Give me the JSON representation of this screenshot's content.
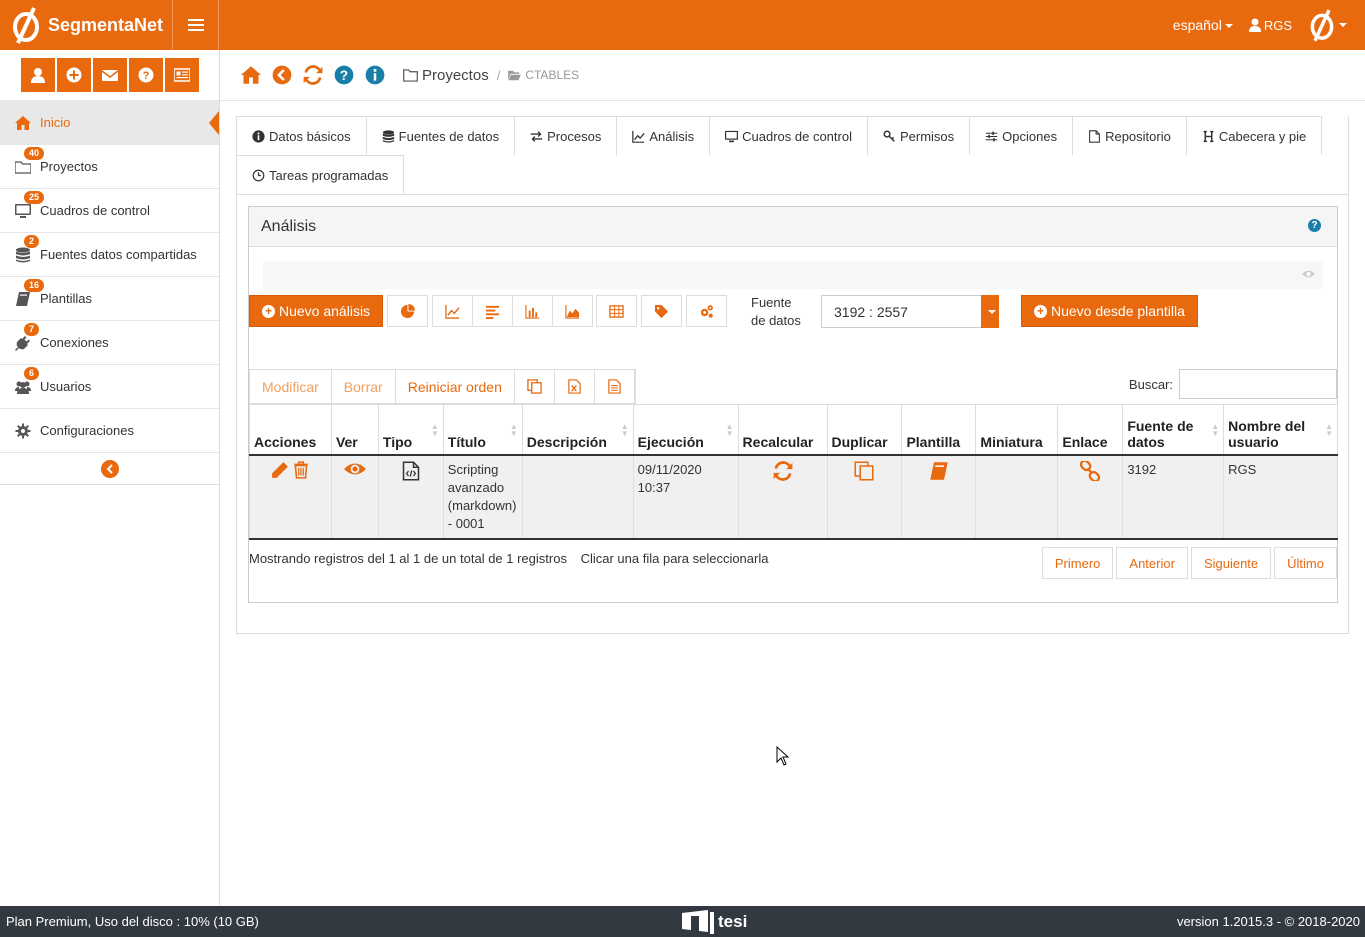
{
  "app": {
    "name": "SegmentaNet",
    "language": "español",
    "user": "RGS"
  },
  "sidebar": {
    "items": [
      {
        "label": "Inicio",
        "badge": ""
      },
      {
        "label": "Proyectos",
        "badge": "40"
      },
      {
        "label": "Cuadros de control",
        "badge": "25"
      },
      {
        "label": "Fuentes datos compartidas",
        "badge": "2"
      },
      {
        "label": "Plantillas",
        "badge": "16"
      },
      {
        "label": "Conexiones",
        "badge": "7"
      },
      {
        "label": "Usuarios",
        "badge": "6"
      },
      {
        "label": "Configuraciones",
        "badge": ""
      }
    ]
  },
  "breadcrumb": {
    "root": "Proyectos",
    "current": "CTABLES"
  },
  "tabs": [
    "Datos básicos",
    "Fuentes de datos",
    "Procesos",
    "Análisis",
    "Cuadros de control",
    "Permisos",
    "Opciones",
    "Repositorio",
    "Cabecera y pie",
    "Tareas programadas"
  ],
  "panel": {
    "title": "Análisis",
    "new_analysis": "Nuevo análisis",
    "source_label": "Fuente de datos",
    "source_value": "3192 : 2557",
    "new_from_template": "Nuevo desde plantilla",
    "actions": {
      "modify": "Modificar",
      "delete": "Borrar",
      "reset_order": "Reiniciar orden"
    },
    "search_label": "Buscar:",
    "search_value": ""
  },
  "table": {
    "headers": [
      "Acciones",
      "Ver",
      "Tipo",
      "Título",
      "Descripción",
      "Ejecución",
      "Recalcular",
      "Duplicar",
      "Plantilla",
      "Miniatura",
      "Enlace",
      "Fuente de datos",
      "Nombre del usuario"
    ],
    "rows": [
      {
        "title": "Scripting avanzado (markdown) - 0001",
        "description": "",
        "execution": "09/11/2020 10:37",
        "source": "3192",
        "user": "RGS"
      }
    ]
  },
  "info": {
    "showing": "Mostrando registros del 1 al 1 de un total de 1 registros",
    "hint": "Clicar una fila para seleccionarla"
  },
  "pager": {
    "first": "Primero",
    "prev": "Anterior",
    "next": "Siguiente",
    "last": "Último"
  },
  "footer": {
    "left": "Plan Premium, Uso del disco : 10% (10 GB)",
    "brand": "tesi",
    "right": "version 1.2015.3 - © 2018-2020"
  },
  "colors": {
    "accent": "#e8690e",
    "footer": "#333940"
  }
}
